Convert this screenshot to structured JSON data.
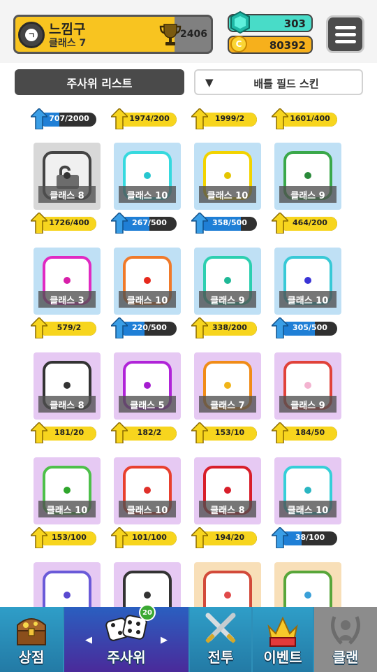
{
  "profile": {
    "rank_symbol": "ㄱ",
    "name": "느낌구",
    "class_label": "클래스 7",
    "trophies": "2406"
  },
  "currency": {
    "gems": "303",
    "coins": "80392",
    "coin_symbol": "C"
  },
  "tabs": {
    "dice_list": "주사위 리스트",
    "battle_skin": "배틀 필드 스킨",
    "skin_arrow": "▼"
  },
  "top_progress": [
    {
      "text": "707/2000",
      "color": "blue",
      "fraction": 0.35
    },
    {
      "text": "1974/200",
      "color": "yellow",
      "fraction": 1
    },
    {
      "text": "1999/2",
      "color": "yellow",
      "fraction": 1
    },
    {
      "text": "1601/400",
      "color": "yellow",
      "fraction": 1
    }
  ],
  "dice_rows": [
    [
      {
        "class": "클래스 8",
        "rarity": "gray",
        "die": "#444444",
        "pip": "#333333",
        "locked": true,
        "progress": "1726/400",
        "pcolor": "yellow",
        "fraction": 1
      },
      {
        "class": "클래스 10",
        "rarity": "blue",
        "die": "#36d9de",
        "pip": "#27c6cf",
        "progress": "267/500",
        "pcolor": "blue",
        "fraction": 0.53
      },
      {
        "class": "클래스 10",
        "rarity": "blue",
        "die": "#f2d300",
        "pip": "#e4c500",
        "progress": "358/500",
        "pcolor": "blue",
        "fraction": 0.72
      },
      {
        "class": "클래스 9",
        "rarity": "blue",
        "die": "#3aa84a",
        "pip": "#2a8a3a",
        "progress": "464/200",
        "pcolor": "yellow",
        "fraction": 1
      }
    ],
    [
      {
        "class": "클래스 3",
        "rarity": "blue",
        "die": "#e02ac2",
        "pip": "#d81fa9",
        "progress": "579/2",
        "pcolor": "yellow",
        "fraction": 1
      },
      {
        "class": "클래스 10",
        "rarity": "blue",
        "die": "#f07a2a",
        "pip": "#e6281c",
        "progress": "220/500",
        "pcolor": "blue",
        "fraction": 0.44
      },
      {
        "class": "클래스 9",
        "rarity": "blue",
        "die": "#2dcfb0",
        "pip": "#1eb896",
        "progress": "338/200",
        "pcolor": "yellow",
        "fraction": 1
      },
      {
        "class": "클래스 10",
        "rarity": "blue",
        "die": "#38c9d6",
        "pip": "#3a34d6",
        "progress": "305/500",
        "pcolor": "blue",
        "fraction": 0.61
      }
    ],
    [
      {
        "class": "클래스 8",
        "rarity": "purple",
        "die": "#333333",
        "pip": "#333333",
        "progress": "181/20",
        "pcolor": "yellow",
        "fraction": 1
      },
      {
        "class": "클래스 5",
        "rarity": "purple",
        "die": "#b024d8",
        "pip": "#a51cd0",
        "progress": "182/2",
        "pcolor": "yellow",
        "fraction": 1
      },
      {
        "class": "클래스 7",
        "rarity": "purple",
        "die": "#f08c18",
        "pip": "#f0b418",
        "progress": "153/10",
        "pcolor": "yellow",
        "fraction": 1
      },
      {
        "class": "클래스 9",
        "rarity": "purple",
        "die": "#e0423a",
        "pip": "#f3b3d0",
        "progress": "184/50",
        "pcolor": "yellow",
        "fraction": 1
      }
    ],
    [
      {
        "class": "클래스 10",
        "rarity": "purple",
        "die": "#4ec04a",
        "pip": "#2fa62c",
        "progress": "153/100",
        "pcolor": "yellow",
        "fraction": 1
      },
      {
        "class": "클래스 10",
        "rarity": "purple",
        "die": "#e8402e",
        "pip": "#e0302a",
        "progress": "101/100",
        "pcolor": "yellow",
        "fraction": 1
      },
      {
        "class": "클래스 8",
        "rarity": "purple",
        "die": "#d81e2a",
        "pip": "#d81e2a",
        "progress": "194/20",
        "pcolor": "yellow",
        "fraction": 1
      },
      {
        "class": "클래스 10",
        "rarity": "purple",
        "die": "#36cfd8",
        "pip": "#2ab6c2",
        "progress": "38/100",
        "pcolor": "blue",
        "fraction": 0.38
      }
    ],
    [
      {
        "rarity": "purple",
        "die": "#6a5ad8",
        "pip": "#5a4ad0"
      },
      {
        "rarity": "purple",
        "die": "#333333",
        "pip": "#333333"
      },
      {
        "rarity": "orange",
        "die": "#d24a3a",
        "pip": "#e04a4a"
      },
      {
        "rarity": "orange",
        "die": "#58a63a",
        "pip": "#3aa0d8"
      }
    ]
  ],
  "nav": {
    "shop": "상점",
    "dice": "주사위",
    "battle": "전투",
    "event": "이벤트",
    "clan": "클랜",
    "dice_badge": "20",
    "arrow_left": "◀",
    "arrow_right": "▶"
  },
  "icons": {
    "rank": "gear-rank-icon",
    "trophy": "trophy-icon",
    "gem": "gem-icon",
    "coin": "coin-icon",
    "menu": "hamburger-menu-icon",
    "upgrade": "up-arrow-icon",
    "lock": "padlock-icon"
  }
}
